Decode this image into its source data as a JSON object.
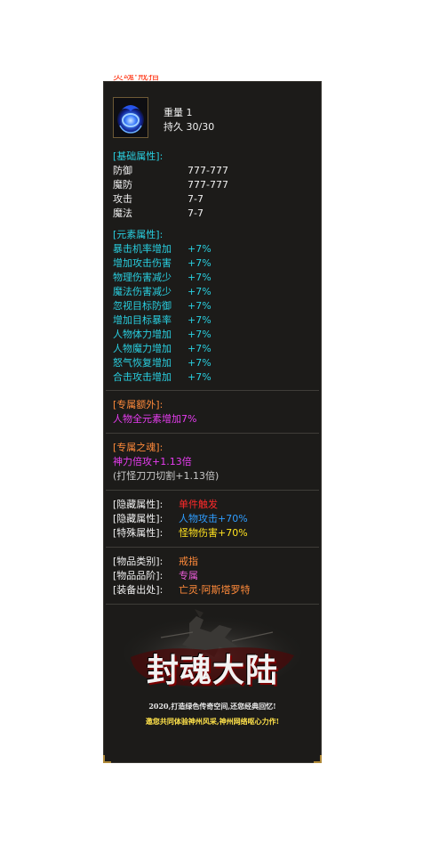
{
  "title": "灵魂·戒指",
  "item": {
    "icon": "blue-ring-icon",
    "weight_label": "重量",
    "weight_value": "1",
    "durability_label": "持久",
    "durability_value": "30/30"
  },
  "basic": {
    "header": "[基础属性]:",
    "rows": [
      {
        "label": "防御",
        "value": "777-777"
      },
      {
        "label": "魔防",
        "value": "777-777"
      },
      {
        "label": "攻击",
        "value": "7-7"
      },
      {
        "label": "魔法",
        "value": "7-7"
      }
    ]
  },
  "element": {
    "header": "[元素属性]:",
    "rows": [
      {
        "label": "暴击机率增加",
        "value": "+7%"
      },
      {
        "label": "增加攻击伤害",
        "value": "+7%"
      },
      {
        "label": "物理伤害减少",
        "value": "+7%"
      },
      {
        "label": "魔法伤害减少",
        "value": "+7%"
      },
      {
        "label": "忽视目标防御",
        "value": "+7%"
      },
      {
        "label": "增加目标暴率",
        "value": "+7%"
      },
      {
        "label": "人物体力增加",
        "value": "+7%"
      },
      {
        "label": "人物魔力增加",
        "value": "+7%"
      },
      {
        "label": "怒气恢复增加",
        "value": "+7%"
      },
      {
        "label": "合击攻击增加",
        "value": "+7%"
      }
    ]
  },
  "exclusive_extra": {
    "header": "[专属额外]:",
    "text": "人物全元素增加7%"
  },
  "exclusive_soul": {
    "header": "[专属之魂]:",
    "line1": "神力倍攻+1.13倍",
    "line2": "(打怪刀刀切割+1.13倍)"
  },
  "hidden": [
    {
      "label": "[隐藏属性]:",
      "value": "单件触发"
    },
    {
      "label": "[隐藏属性]:",
      "value": "人物攻击+70%"
    },
    {
      "label": "[特殊属性]:",
      "value": "怪物伤害+70%"
    }
  ],
  "info": [
    {
      "label": "[物品类别]:",
      "value": "戒指"
    },
    {
      "label": "[物品品阶]:",
      "value": "专属"
    },
    {
      "label": "[装备出处]:",
      "value": "亡灵·阿斯塔罗特"
    }
  ],
  "banner": {
    "logo_text": "封魂大陆",
    "line1": "2020,打造绿色传奇空间,还您经典回忆!",
    "line2": "邀您共同体验神州风采,神州网络呕心力作!"
  },
  "colors": {
    "background": "#1c1b19",
    "cyan": "#29cfe0",
    "orange": "#ff8a3a",
    "magenta": "#e63cf0",
    "red": "#ff2a2a",
    "blue": "#2e9dff",
    "yellow": "#ffe21f"
  }
}
